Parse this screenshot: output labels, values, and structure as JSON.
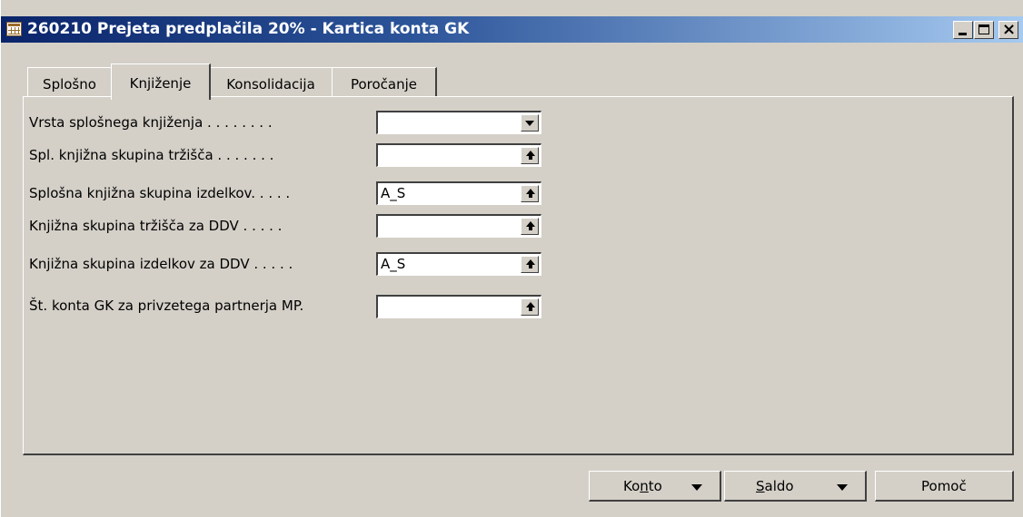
{
  "window": {
    "title": "260210 Prejeta predplačila 20% - Kartica konta GK",
    "icon": "table-icon",
    "controls": [
      "minimize-icon",
      "maximize-icon",
      "close-icon"
    ],
    "close_glyph": "×"
  },
  "tabs": [
    {
      "label": "Splošno",
      "active": false
    },
    {
      "label": "Knjiženje",
      "active": true
    },
    {
      "label": "Konsolidacija",
      "active": false
    },
    {
      "label": "Poročanje",
      "active": false
    }
  ],
  "fields": [
    {
      "label": "Vrsta splošnega knjiženja . . . . . . . .",
      "value": "",
      "button": "dropdown"
    },
    {
      "label": "Spl. knjižna skupina tržišča . . . . . . .",
      "value": "",
      "button": "lookup"
    },
    {
      "label": "Splošna knjižna skupina izdelkov. . . . .",
      "value": "A_S",
      "button": "lookup"
    },
    {
      "label": "Knjižna skupina tržišča za DDV . . . . .",
      "value": "",
      "button": "lookup"
    },
    {
      "label": "Knjižna skupina izdelkov za DDV . . . . .",
      "value": "A_S",
      "button": "lookup"
    },
    {
      "label": "Št. konta GK za privzetega partnerja MP.",
      "value": "",
      "button": "lookup"
    }
  ],
  "buttons": {
    "konto": {
      "label_pre": "Ko",
      "label_ul": "n",
      "label_post": "to",
      "has_menu": true
    },
    "saldo": {
      "label_pre": "",
      "label_ul": "S",
      "label_post": "aldo",
      "has_menu": true
    },
    "pomoc": {
      "label": "Pomoč",
      "has_menu": false
    }
  }
}
